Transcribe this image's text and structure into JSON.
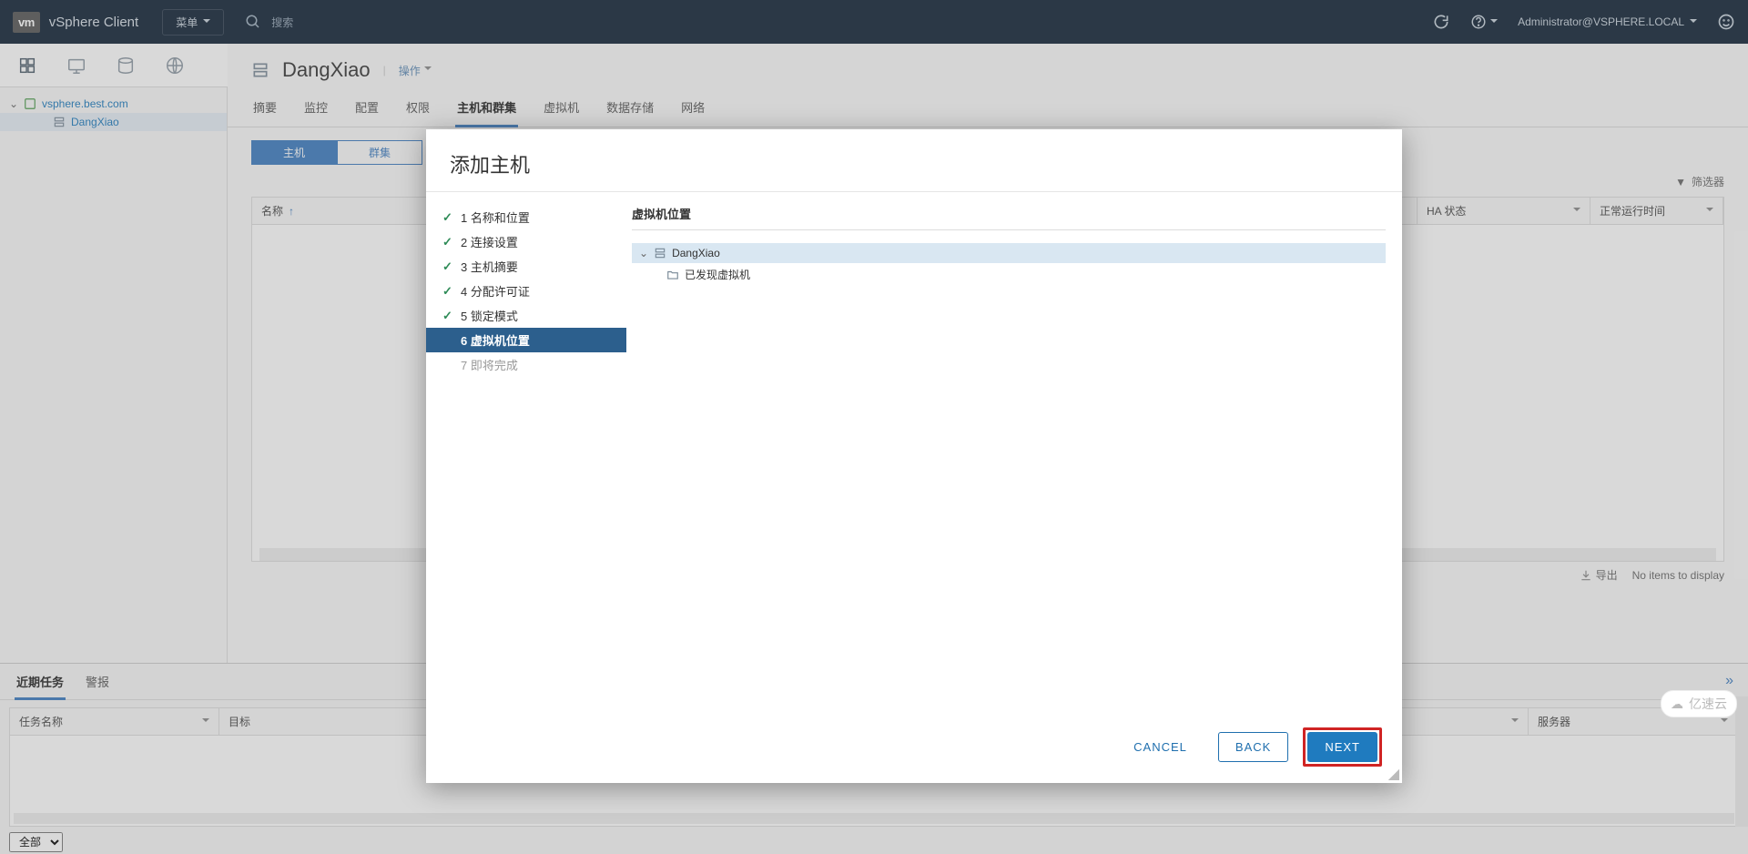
{
  "topbar": {
    "logo": "vm",
    "brand": "vSphere Client",
    "menu": "菜单",
    "search_placeholder": "搜索",
    "user": "Administrator@VSPHERE.LOCAL"
  },
  "tree": {
    "root": "vsphere.best.com",
    "child": "DangXiao"
  },
  "object": {
    "title": "DangXiao",
    "actions": "操作"
  },
  "tabs": {
    "summary": "摘要",
    "monitor": "监控",
    "config": "配置",
    "perm": "权限",
    "hosts": "主机和群集",
    "vms": "虚拟机",
    "datastores": "数据存储",
    "networks": "网络"
  },
  "subtabs": {
    "hosts": "主机",
    "clusters": "群集"
  },
  "grid": {
    "filter": "筛选器",
    "col_name": "名称",
    "col_ha": "HA 状态",
    "col_uptime": "正常运行时间",
    "export": "导出",
    "no_items": "No items to display"
  },
  "tasks": {
    "recent": "近期任务",
    "alarms": "警报",
    "col_task": "任务名称",
    "col_target": "目标",
    "col_server": "服务器",
    "all": "全部"
  },
  "dialog": {
    "title": "添加主机",
    "steps": {
      "s1": "1 名称和位置",
      "s2": "2 连接设置",
      "s3": "3 主机摘要",
      "s4": "4 分配许可证",
      "s5": "5 锁定模式",
      "s6": "6 虚拟机位置",
      "s7": "7 即将完成"
    },
    "panel_title": "虚拟机位置",
    "loc_root": "DangXiao",
    "loc_child": "已发现虚拟机",
    "cancel": "CANCEL",
    "back": "BACK",
    "next": "NEXT"
  },
  "watermark": "亿速云"
}
